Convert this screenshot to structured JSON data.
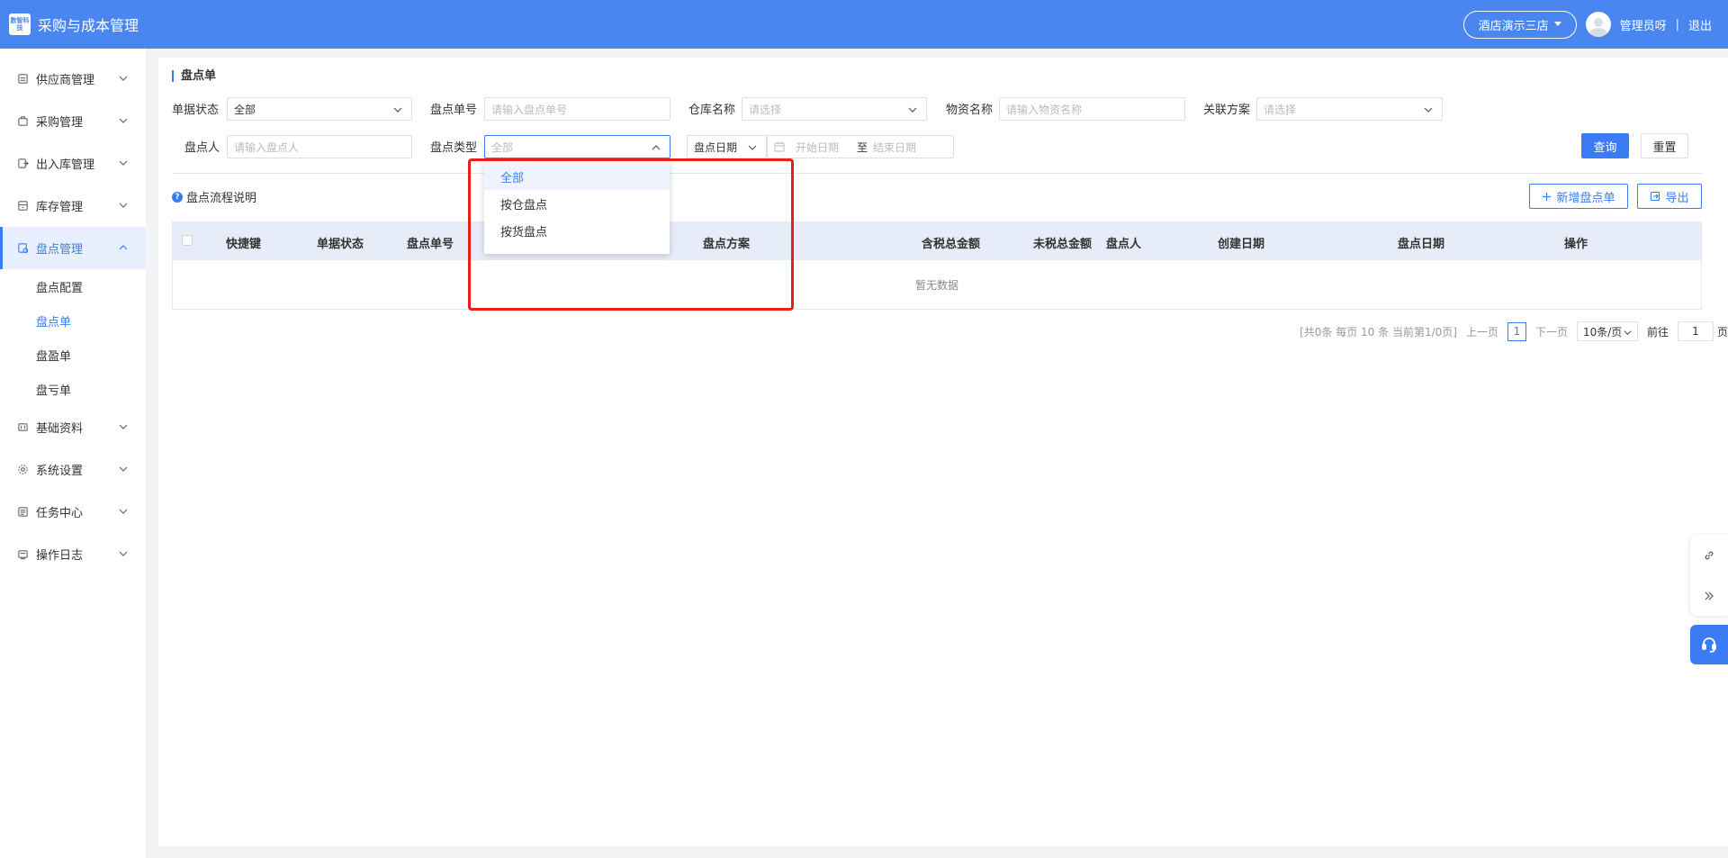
{
  "header": {
    "logo_text": "数智科技",
    "title": "采购与成本管理",
    "store": "酒店演示三店",
    "user": "管理员呀",
    "separator": "|",
    "logout": "退出"
  },
  "sidebar": {
    "items": [
      {
        "label": "供应商管理",
        "icon": "supplier-icon"
      },
      {
        "label": "采购管理",
        "icon": "purchase-icon"
      },
      {
        "label": "出入库管理",
        "icon": "inout-icon"
      },
      {
        "label": "库存管理",
        "icon": "inventory-icon"
      },
      {
        "label": "盘点管理",
        "icon": "stocktake-icon",
        "active": true
      },
      {
        "label": "基础资料",
        "icon": "basic-data-icon"
      },
      {
        "label": "系统设置",
        "icon": "gear-icon"
      },
      {
        "label": "任务中心",
        "icon": "task-icon"
      },
      {
        "label": "操作日志",
        "icon": "log-icon"
      }
    ],
    "subitems": [
      {
        "label": "盘点配置"
      },
      {
        "label": "盘点单",
        "active": true
      },
      {
        "label": "盘盈单"
      },
      {
        "label": "盘亏单"
      }
    ]
  },
  "page": {
    "title": "盘点单"
  },
  "filters": {
    "status_label": "单据状态",
    "status_value": "全部",
    "order_no_label": "盘点单号",
    "order_no_placeholder": "请输入盘点单号",
    "warehouse_label": "仓库名称",
    "warehouse_placeholder": "请选择",
    "material_label": "物资名称",
    "material_placeholder": "请输入物资名称",
    "plan_label": "关联方案",
    "plan_placeholder": "请选择",
    "person_label": "盘点人",
    "person_placeholder": "请输入盘点人",
    "type_label": "盘点类型",
    "type_placeholder": "全部",
    "date_type": "盘点日期",
    "start_placeholder": "开始日期",
    "to": "至",
    "end_placeholder": "结束日期"
  },
  "buttons": {
    "query": "查询",
    "reset": "重置",
    "add": "新增盘点单",
    "export": "导出"
  },
  "help": {
    "label": "盘点流程说明"
  },
  "table": {
    "columns": [
      "快捷键",
      "单据状态",
      "盘点单号",
      "盘点方案",
      "含税总金额",
      "未税总金额",
      "盘点人",
      "创建日期",
      "盘点日期",
      "操作"
    ],
    "empty_text": "暂无数据"
  },
  "pagination": {
    "summary": "[共0条 每页 10 条 当前第1/0页]",
    "prev": "上一页",
    "current": "1",
    "next": "下一页",
    "page_size": "10条/页",
    "goto_label": "前往",
    "goto_value": "1",
    "page_unit": "页"
  },
  "dropdown": {
    "options": [
      {
        "label": "全部",
        "selected": true
      },
      {
        "label": "按仓盘点"
      },
      {
        "label": "按货盘点"
      }
    ]
  },
  "colors": {
    "header": "#4a86f0",
    "primary": "#3b7cf4",
    "highlight": "#e8201a"
  }
}
